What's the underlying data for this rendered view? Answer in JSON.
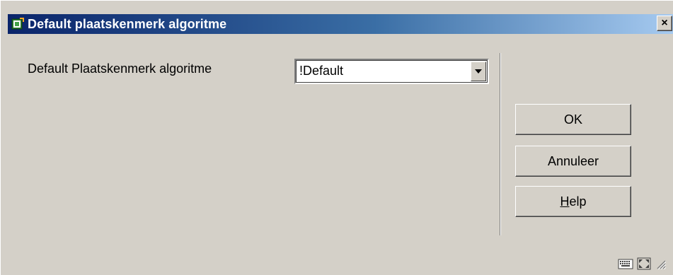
{
  "window": {
    "title": "Default plaatskenmerk algoritme",
    "close_symbol": "×"
  },
  "form": {
    "label": "Default Plaatskenmerk algoritme",
    "select_value": "!Default"
  },
  "buttons": {
    "ok": "OK",
    "cancel": "Annuleer",
    "help_mnemonic": "H",
    "help_rest": "elp"
  },
  "icons": {
    "app": "app-window-icon",
    "dropdown": "chevron-down-icon",
    "status_left": "keyboard-icon",
    "status_right": "maximize-icon",
    "grip": "resize-grip-icon"
  }
}
